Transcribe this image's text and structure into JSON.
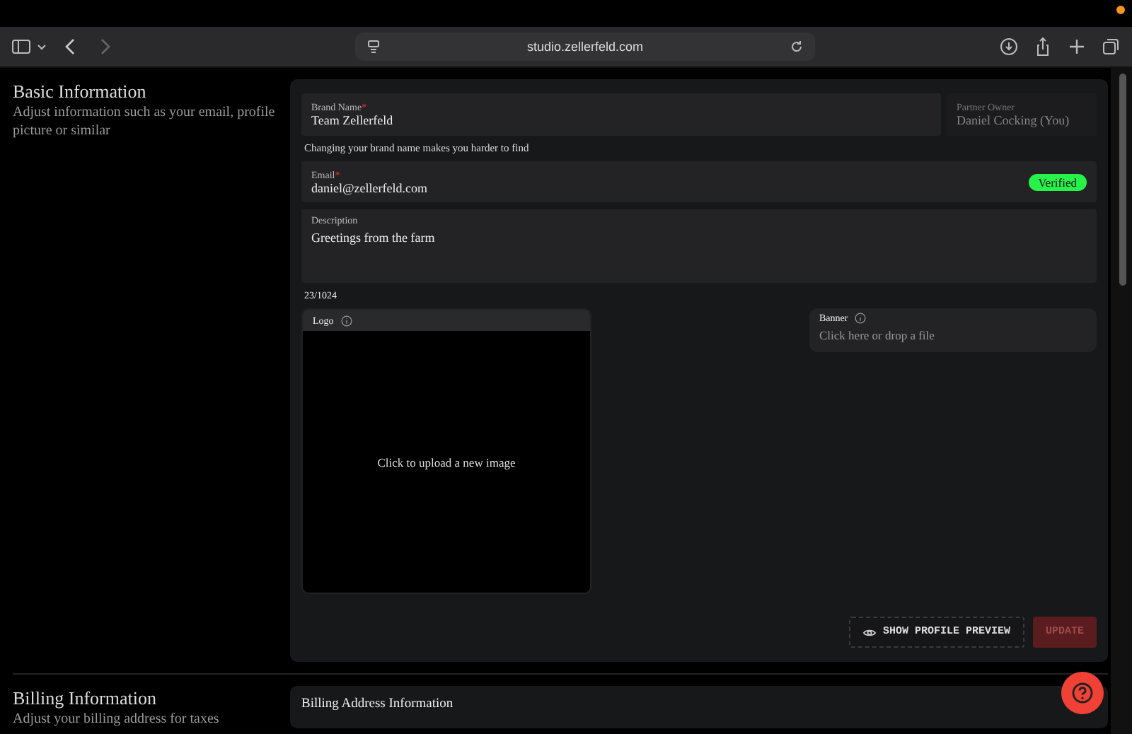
{
  "browser": {
    "url": "studio.zellerfeld.com"
  },
  "basic": {
    "title": "Basic Information",
    "subtitle": "Adjust information such as your email, profile picture or similar",
    "brand_name": {
      "label": "Brand Name",
      "required_mark": "*",
      "value": "Team Zellerfeld"
    },
    "brand_hint": "Changing your brand name makes you harder to find",
    "partner_owner": {
      "label": "Partner Owner",
      "value": "Daniel Cocking (You)",
      "disabled": true
    },
    "email": {
      "label": "Email",
      "required_mark": "*",
      "value": "daniel@zellerfeld.com",
      "badge": "Verified"
    },
    "description": {
      "label": "Description",
      "value": "Greetings from the farm"
    },
    "char_count": "23/1024",
    "logo": {
      "label": "Logo",
      "prompt": "Click to upload a new image"
    },
    "banner": {
      "label": "Banner",
      "placeholder": "Click here or drop a file"
    },
    "preview_button": "SHOW PROFILE PREVIEW",
    "update_button": {
      "label": "UPDATE",
      "disabled": true
    }
  },
  "billing": {
    "title": "Billing Information",
    "subtitle": "Adjust your billing address for taxes",
    "card_title": "Billing Address Information"
  }
}
